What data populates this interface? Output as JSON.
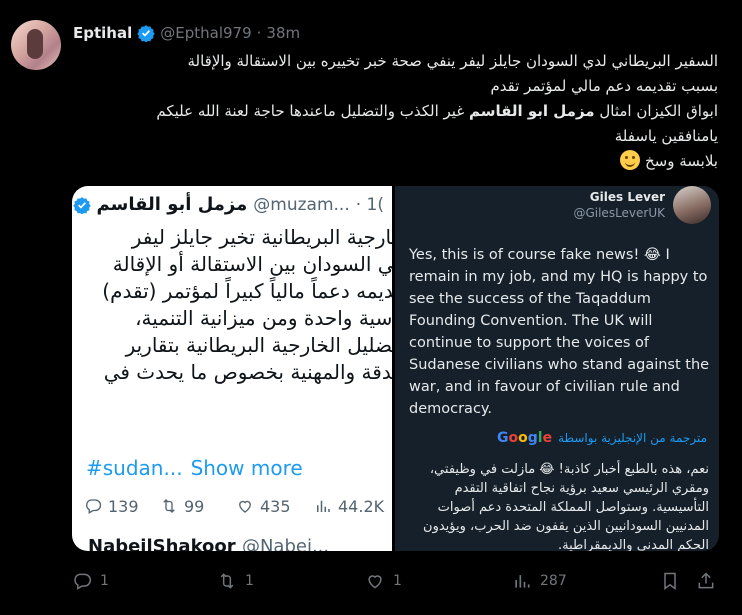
{
  "author": {
    "name": "Eptihal",
    "handle": "@Epthal979",
    "separator": "·",
    "time": "38m"
  },
  "body": {
    "line1": "السفير البريطاني لدي السودان جايلز ليفر ينفي صحة خبر تخييره بين الاستقالة والإقالة",
    "line2": "بسبب تقديمه دعم مالي لمؤتمر تقدم",
    "line3_pre": "ابواق الكيزان امثال ",
    "line3_bold": "مزمل ابو القاسم",
    "line3_post": " غير الكذب والتضليل ماعندها حاجة لعنة الله عليكم",
    "line4": "يامنافقين ياسفلة",
    "line5": "بلابسة وسخ"
  },
  "media_left": {
    "name": "مزمل أبو القاسم",
    "handle": "@muzam...",
    "separator": "· 1(",
    "lines": [
      "خارجية البريطانية تخير جايلز ليفر",
      "في السودان بين الاستقالة أو الإقالة",
      "قديمه دعماً مالياً كبيراً لمؤتمر (تقدم)",
      "ياسية واحدة ومن ميزانية التنمية،",
      "بتضليل الخارجية البريطانية بتقارير",
      "الدقة والمهنية بخصوص ما يحدث في",
      "؟"
    ],
    "hashtag": "#sudan...",
    "show_more": "Show more",
    "stats": {
      "replies": "139",
      "reposts": "99",
      "likes": "435",
      "views": "44.2K"
    },
    "next_author": "NabeilShakoor",
    "next_handle": "@Nabei..."
  },
  "media_right": {
    "name": "Giles Lever",
    "handle": "@GilesLeverUK",
    "english": "Yes, this is of course fake news! 😂 I remain in my job, and my HQ is happy to see the success of the Taqaddum Founding Convention.  The UK will continue to support the voices of Sudanese civilians who stand against the war, and in favour of civilian rule and democracy.",
    "translated_by": "مترجمة من الإنجليزية بواسطة",
    "google": [
      "G",
      "o",
      "o",
      "g",
      "l",
      "e"
    ],
    "arabic": [
      "نعم، هذه بالطبع أخبار كاذبة! 😂 مازلت في وظيفتي،",
      "ومقري الرئيسي سعيد برؤية نجاح اتفاقية التقدم",
      "التأسيسية. وستواصل المملكة المتحدة دعم أصوات",
      "المدنيين السودانيين الذين يقفون ضد الحرب، ويؤيدون",
      "الحكم المدني والديمقراطية."
    ]
  },
  "actions": {
    "replies": "1",
    "reposts": "1",
    "likes": "1",
    "views": "287"
  },
  "colors": {
    "background": "#000000",
    "accent": "#1d9bf0",
    "muted": "#71767b",
    "text": "#e7e9ea"
  }
}
